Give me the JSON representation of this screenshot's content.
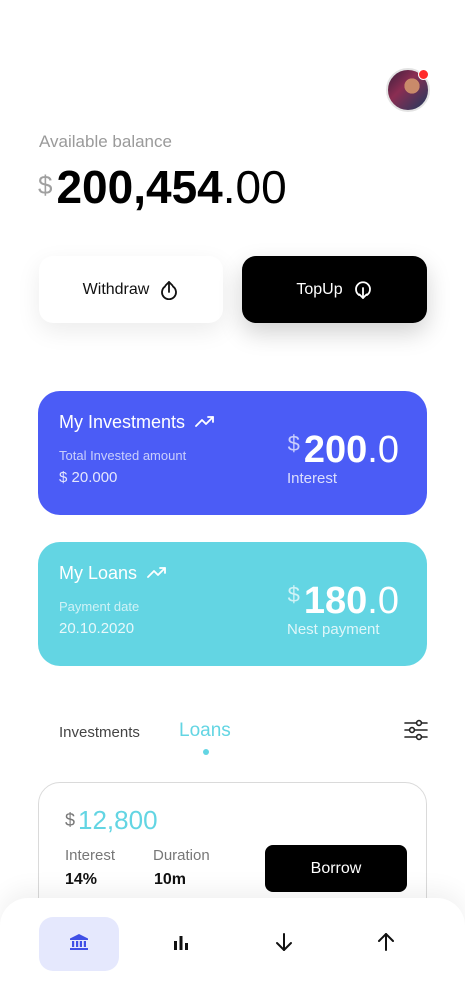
{
  "header": {
    "avatar_alt": "User profile"
  },
  "balance": {
    "label": "Available balance",
    "currency": "$",
    "integer": "200,454",
    "decimal": ".00"
  },
  "actions": {
    "withdraw_label": "Withdraw",
    "topup_label": "TopUp"
  },
  "investments_card": {
    "title": "My Investments",
    "sub_label": "Total Invested amount",
    "sub_value": "$ 20.000",
    "currency": "$",
    "amount_integer": "200",
    "amount_decimal": ".0",
    "amount_label": "Interest",
    "color": "#4b5cf6"
  },
  "loans_card": {
    "title": "My Loans",
    "sub_label": "Payment date",
    "sub_value": "20.10.2020",
    "currency": "$",
    "amount_integer": "180",
    "amount_decimal": ".0",
    "amount_label": "Nest payment",
    "color": "#63d5e3"
  },
  "tabs": {
    "items": [
      "Investments",
      "Loans"
    ],
    "active": "Loans"
  },
  "loan_offer": {
    "currency": "$",
    "amount": "12,800",
    "interest_label": "Interest",
    "interest_value": "14%",
    "duration_label": "Duration",
    "duration_value": "10m",
    "borrow_label": "Borrow"
  },
  "bottom_nav": {
    "items": [
      "bank-icon",
      "bar-chart-icon",
      "arrow-down-icon",
      "arrow-up-icon"
    ],
    "active": "bank-icon"
  },
  "colors": {
    "accent_blue": "#4b5cf6",
    "accent_cyan": "#63d5e3",
    "notification": "#ff2a2a"
  }
}
